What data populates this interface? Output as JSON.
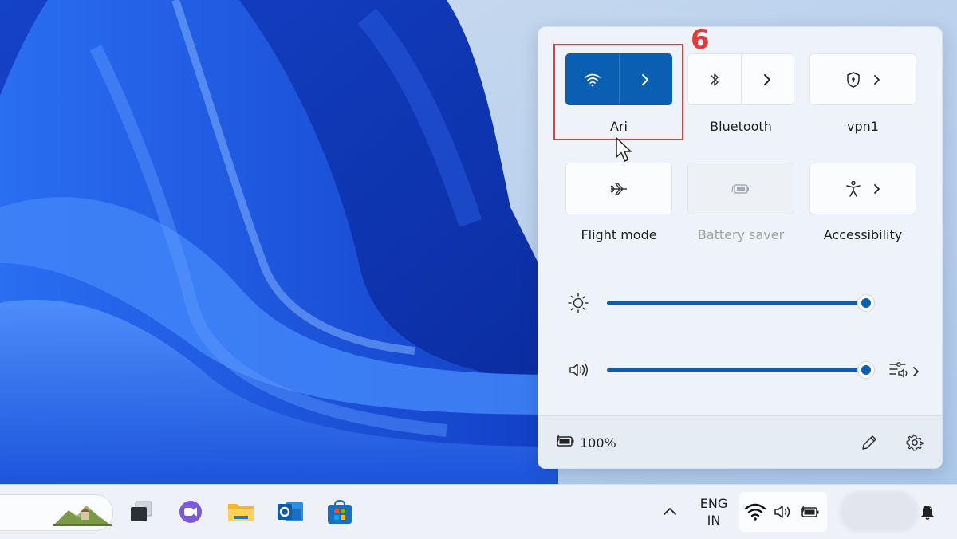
{
  "annotation": {
    "step_number": "6"
  },
  "quick_settings": {
    "tiles": [
      {
        "label": "Ari",
        "state": "on",
        "icon": "wifi-icon",
        "has_expand": true
      },
      {
        "label": "Bluetooth",
        "state": "off",
        "icon": "bluetooth-icon",
        "has_expand": true
      },
      {
        "label": "vpn1",
        "state": "off",
        "icon": "shield-icon",
        "has_expand": true
      },
      {
        "label": "Flight mode",
        "state": "off",
        "icon": "airplane-icon",
        "has_expand": false
      },
      {
        "label": "Battery saver",
        "state": "disabled",
        "icon": "battery-saver-icon",
        "has_expand": false
      },
      {
        "label": "Accessibility",
        "state": "off",
        "icon": "accessibility-icon",
        "has_expand": true
      }
    ],
    "brightness": {
      "icon": "brightness-icon",
      "level_percent": 100
    },
    "volume": {
      "icon": "speaker-icon",
      "level_percent": 100,
      "mixer_icon": "sound-mixer-icon"
    },
    "footer": {
      "battery_icon": "battery-charging-icon",
      "battery_text": "100%",
      "edit_icon": "pencil-icon",
      "settings_icon": "gear-icon"
    }
  },
  "taskbar": {
    "apps": [
      "landscape-widget-icon",
      "task-view-icon",
      "teams-chat-icon",
      "file-explorer-icon",
      "outlook-icon",
      "microsoft-store-icon"
    ],
    "tray": {
      "language_line1": "ENG",
      "language_line2": "IN",
      "chevron_icon": "chevron-up-icon"
    }
  },
  "colors": {
    "accent": "#0a5fb3",
    "highlight": "#e23b3b"
  }
}
